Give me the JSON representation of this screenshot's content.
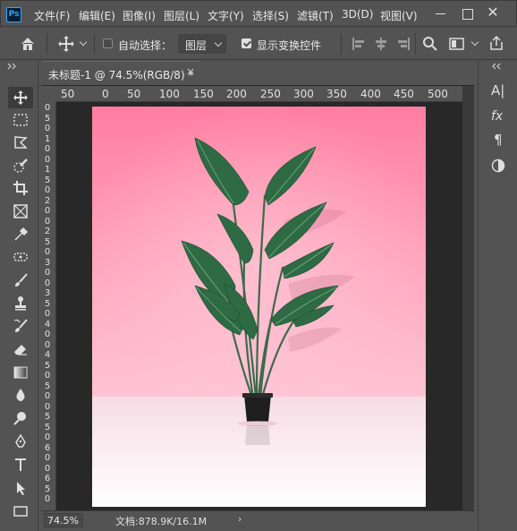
{
  "app": {
    "logo_text": "Ps"
  },
  "menu": [
    "文件(F)",
    "编辑(E)",
    "图像(I)",
    "图层(L)",
    "文字(Y)",
    "选择(S)",
    "滤镜(T)",
    "3D(D)",
    "视图(V)"
  ],
  "window_controls": {
    "close_glyph": "✕"
  },
  "options_bar": {
    "tool_icon": "move-icon",
    "auto_select_label": "自动选择：",
    "auto_select_checked": false,
    "target_value": "图层",
    "show_transform_label": "显示变换控件",
    "show_transform_checked": true
  },
  "tools": [
    "move-tool",
    "marquee-tool",
    "lasso-tool",
    "quick-selection-tool",
    "crop-tool",
    "frame-tool",
    "eyedropper-tool",
    "spot-healing-tool",
    "brush-tool",
    "clone-stamp-tool",
    "history-brush-tool",
    "eraser-tool",
    "gradient-tool",
    "blur-tool",
    "dodge-tool",
    "pen-tool",
    "type-tool",
    "path-selection-tool",
    "rectangle-tool"
  ],
  "document": {
    "tab_title": "未标题-1 @ 74.5%(RGB/8) *",
    "close_glyph": "×"
  },
  "ruler_h": [
    "50",
    "0",
    "50",
    "100",
    "150",
    "200",
    "250",
    "300",
    "350",
    "400",
    "450",
    "500"
  ],
  "ruler_v": [
    "0",
    "5",
    "0",
    "1",
    "0",
    "0",
    "1",
    "5",
    "0",
    "2",
    "0",
    "0",
    "2",
    "5",
    "0",
    "3",
    "0",
    "0",
    "3",
    "5",
    "0",
    "4",
    "0",
    "0",
    "4",
    "5",
    "0",
    "5",
    "0",
    "0",
    "5",
    "5",
    "0",
    "6",
    "0",
    "0",
    "6",
    "5",
    "0"
  ],
  "status": {
    "zoom": "74.5%",
    "doc_size": "文档:878.9K/16.1M",
    "arrow": "›"
  },
  "right_panel": {
    "text_panel_label": "A|",
    "fx_label": "fx",
    "paragraph_label": "¶"
  },
  "colors": {
    "background": "#535353",
    "canvas_pink_top": "#ff7fa0",
    "canvas_pink_bottom": "#ffc3d3",
    "floor_top": "#f6dbe4",
    "floor_bottom": "#ffffff",
    "leaf": "#2f6b45",
    "pot": "#1e1e1e"
  }
}
